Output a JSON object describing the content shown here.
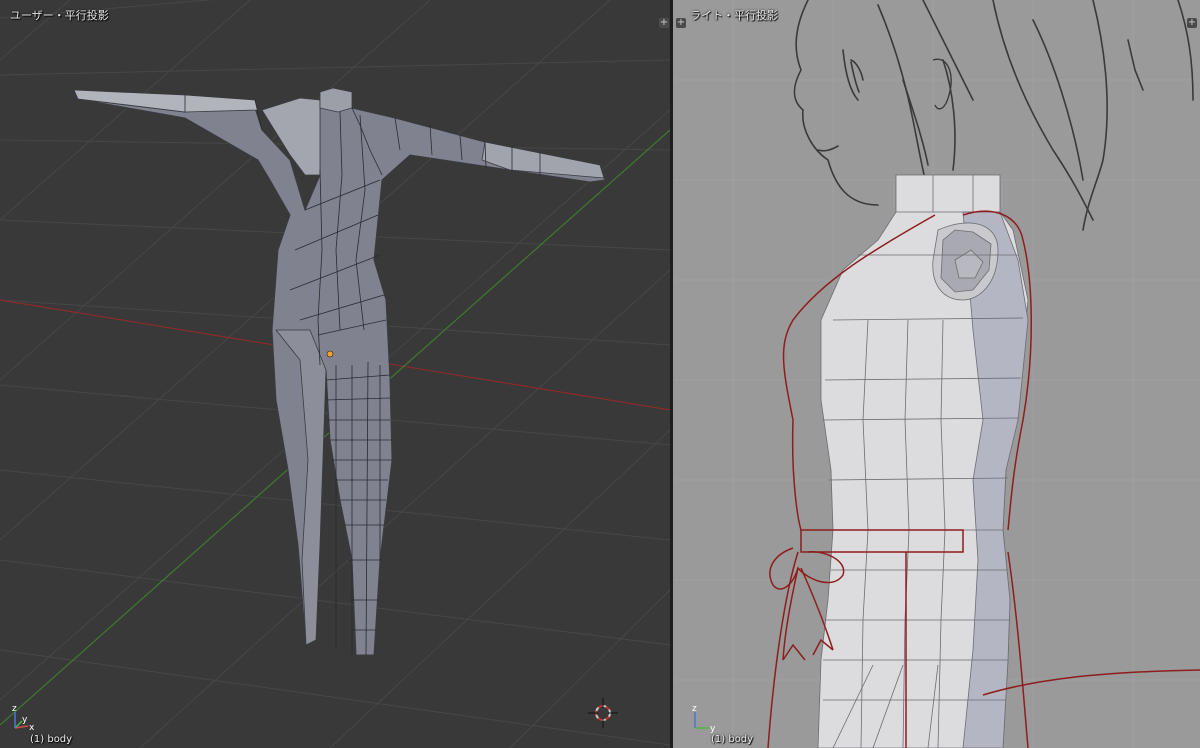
{
  "left_viewport": {
    "title": "ユーザー・平行投影",
    "object_label": "(1) body",
    "corner_button": "+",
    "axis_labels": {
      "x": "x",
      "y": "y",
      "z": "z"
    }
  },
  "right_viewport": {
    "title": "ライト・平行投影",
    "object_label": "(1) body",
    "corner_button": "+",
    "axis_labels": {
      "y": "y",
      "z": "z"
    }
  },
  "colors": {
    "viewport_bg": "#393939",
    "grid": "#474747",
    "x_axis": "#8a2b2b",
    "y_axis": "#3e7a2e",
    "mesh": "#7d7f89",
    "mesh_light": "#b2b4bc",
    "reference_bg": "#9a9a9a",
    "reference_outline": "#8e1d1d",
    "sketch": "#333333"
  }
}
